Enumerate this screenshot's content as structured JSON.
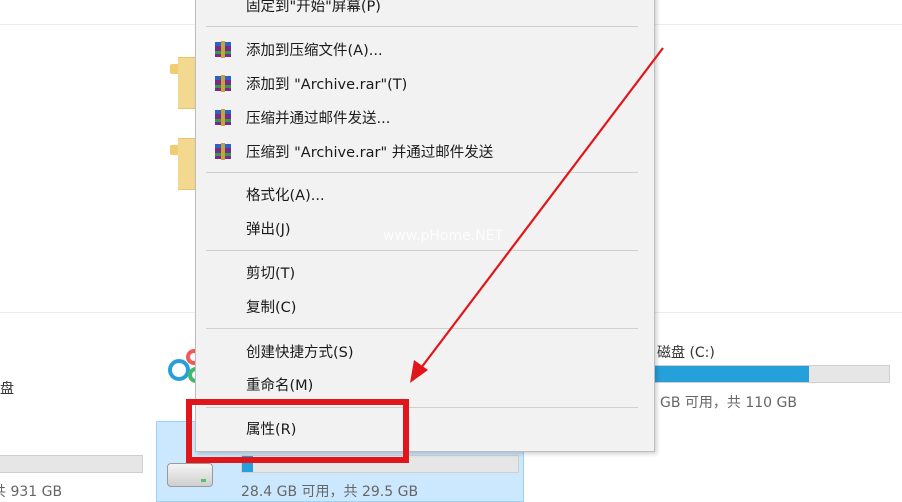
{
  "context_menu": {
    "items": {
      "pin_start": "固定到\"开始\"屏幕(P)",
      "add_archive": "添加到压缩文件(A)...",
      "add_rar": "添加到 \"Archive.rar\"(T)",
      "compress_email": "压缩并通过邮件发送...",
      "compress_rar_email": "压缩到 \"Archive.rar\" 并通过邮件发送",
      "format": "格式化(A)...",
      "eject": "弹出(J)",
      "cut": "剪切(T)",
      "copy": "复制(C)",
      "create_shortcut": "创建快捷方式(S)",
      "rename": "重命名(M)",
      "properties": "属性(R)"
    },
    "icons": {
      "winrar": "winrar-icon"
    }
  },
  "drives": {
    "left_label": "盘",
    "left_size": "共 931 GB",
    "c_label": "磁盘 (C:)",
    "c_size": "GB 可用，共 110 GB",
    "c_used_fraction": 0.66,
    "usb_size": "28.4 GB 可用，共 29.5 GB",
    "usb_used_fraction": 0.04
  },
  "watermark": "www.pHome.NET",
  "annotation": {
    "color": "#e1161a"
  }
}
